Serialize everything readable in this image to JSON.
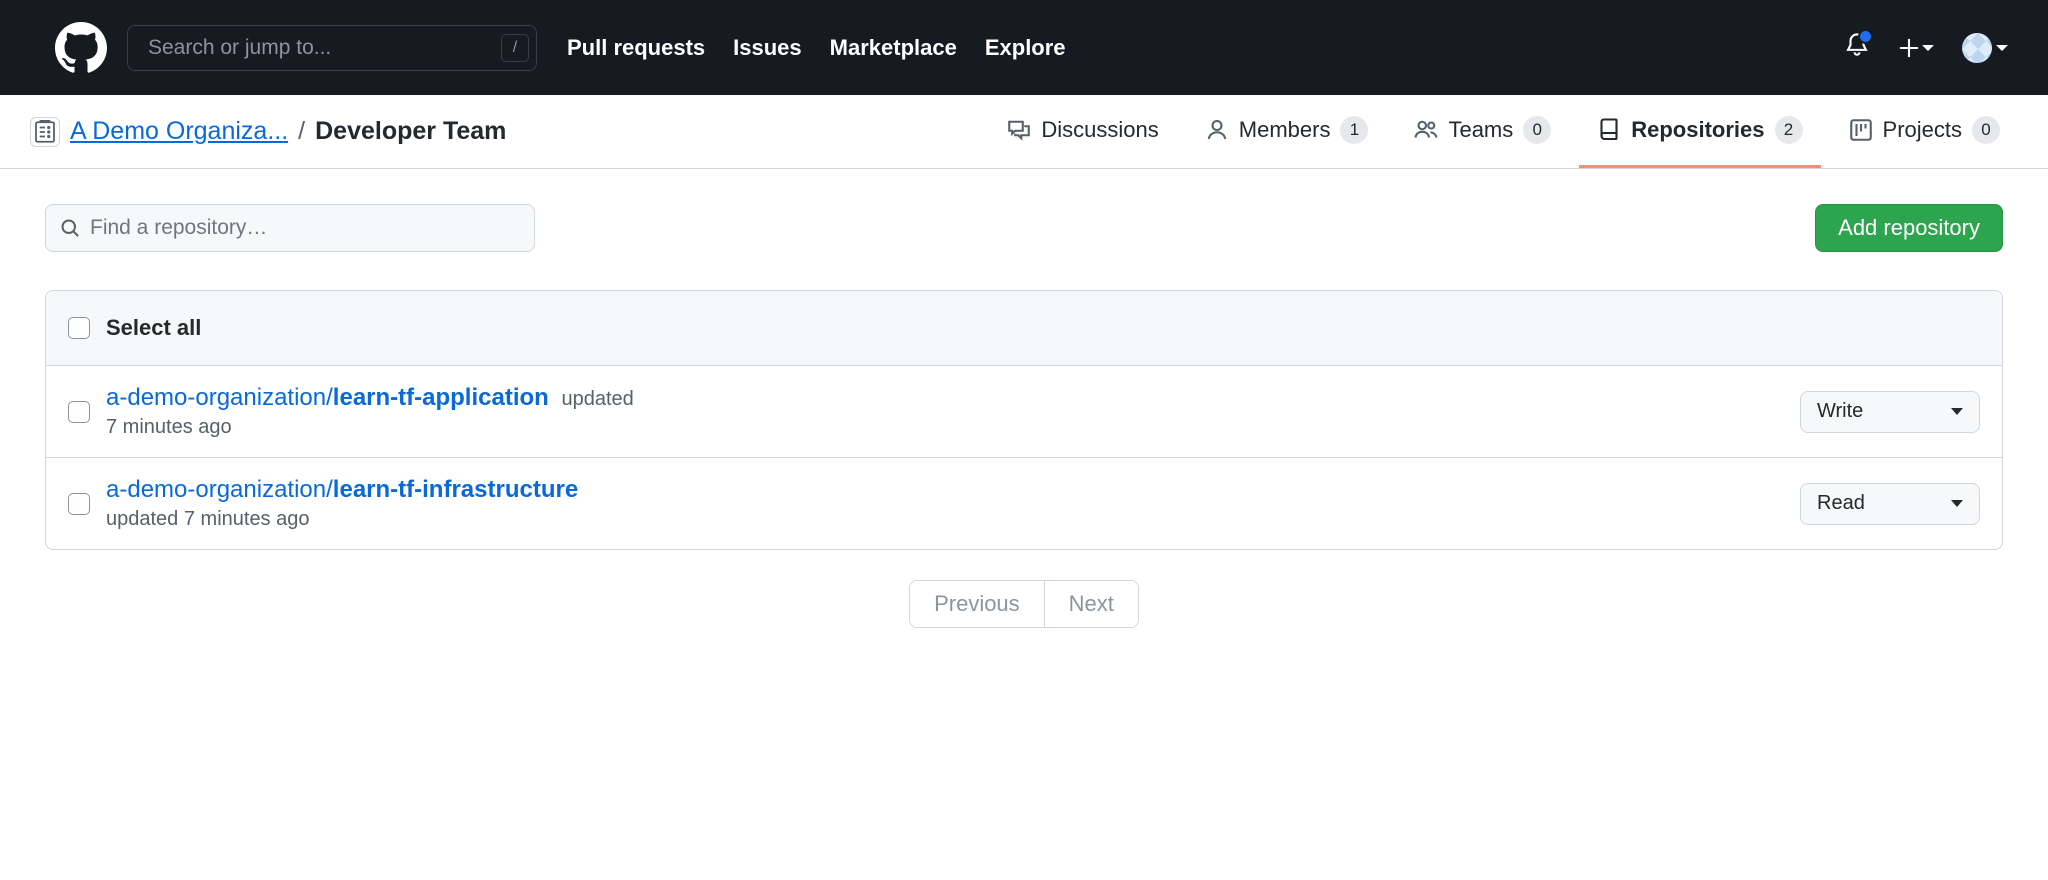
{
  "topbar": {
    "search_placeholder": "Search or jump to...",
    "slash": "/",
    "nav": {
      "pull_requests": "Pull requests",
      "issues": "Issues",
      "marketplace": "Marketplace",
      "explore": "Explore"
    }
  },
  "breadcrumb": {
    "org": "A Demo Organiza...",
    "sep": "/",
    "team": "Developer Team"
  },
  "tabs": {
    "discussions": {
      "label": "Discussions"
    },
    "members": {
      "label": "Members",
      "count": "1"
    },
    "teams": {
      "label": "Teams",
      "count": "0"
    },
    "repositories": {
      "label": "Repositories",
      "count": "2"
    },
    "projects": {
      "label": "Projects",
      "count": "0"
    }
  },
  "toolbar": {
    "find_placeholder": "Find a repository…",
    "add_repo": "Add repository"
  },
  "list": {
    "select_all": "Select all",
    "rows": [
      {
        "owner": "a-demo-organization/",
        "name": "learn-tf-application",
        "meta_inline": "updated",
        "meta_below": "7 minutes ago",
        "permission": "Write"
      },
      {
        "owner": "a-demo-organization/",
        "name": "learn-tf-infrastructure",
        "meta_inline": "",
        "meta_below": "updated 7 minutes ago",
        "permission": "Read"
      }
    ]
  },
  "pagination": {
    "previous": "Previous",
    "next": "Next"
  }
}
